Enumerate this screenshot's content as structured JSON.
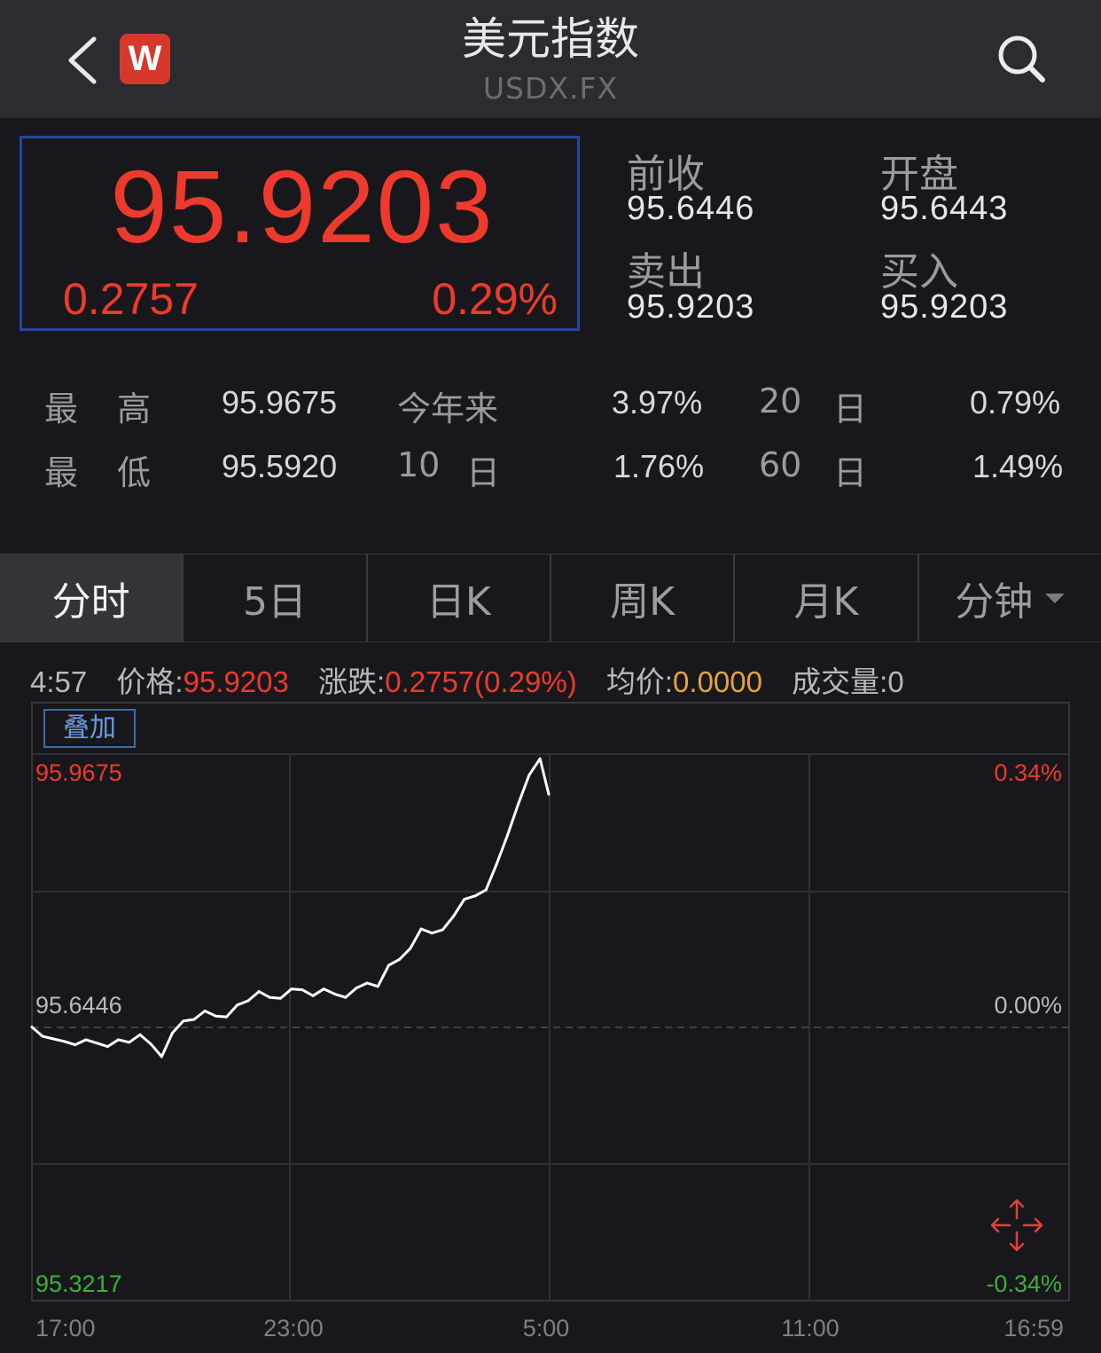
{
  "header": {
    "back_icon": "chevron-left-icon",
    "logo_text": "W",
    "title": "美元指数",
    "code": "USDX.FX",
    "search_icon": "search-icon"
  },
  "quote": {
    "price": "95.9203",
    "change": "0.2757",
    "change_pct": "0.29%",
    "prev_close_label": "前收",
    "prev_close": "95.6446",
    "open_label": "开盘",
    "open": "95.6443",
    "sell_label": "卖出",
    "sell": "95.9203",
    "buy_label": "买入",
    "buy": "95.9203"
  },
  "stats": {
    "high_label_1": "最",
    "high_label_2": "高",
    "high": "95.9675",
    "low_label_1": "最",
    "low_label_2": "低",
    "low": "95.5920",
    "ytd_label": "今年来",
    "ytd": "3.97%",
    "d10_num": "10",
    "d10_unit": "日",
    "d10": "1.76%",
    "d20_num": "20",
    "d20_unit": "日",
    "d20": "0.79%",
    "d60_num": "60",
    "d60_unit": "日",
    "d60": "1.49%"
  },
  "tabs": [
    {
      "label": "分时",
      "active": true
    },
    {
      "label": "5日"
    },
    {
      "label": "日K"
    },
    {
      "label": "周K"
    },
    {
      "label": "月K"
    },
    {
      "label": "分钟",
      "dropdown": true
    }
  ],
  "info": {
    "time": "4:57",
    "price_label": "价格:",
    "price": "95.9203",
    "change_label": "涨跌:",
    "change": "0.2757(0.29%)",
    "avg_label": "均价:",
    "avg": "0.0000",
    "volume_label": "成交量:",
    "volume": "0"
  },
  "overlay_button": "叠加",
  "colors": {
    "up": "#ee3a2c",
    "down": "#3fae3a",
    "accent_blue": "#2545a0",
    "avg": "#e6a23c",
    "line": "#ffffff"
  },
  "chart_data": {
    "type": "line",
    "y_left_ticks": [
      "95.9675",
      "95.6446",
      "95.3217"
    ],
    "y_right_ticks": [
      "0.34%",
      "0.00%",
      "-0.34%"
    ],
    "x_ticks": [
      "17:00",
      "23:00",
      "5:00",
      "11:00",
      "16:59"
    ],
    "ylim": [
      95.3217,
      95.9675
    ],
    "reference": 95.6446,
    "x_range_minutes": [
      0,
      1439
    ],
    "series": [
      {
        "x": [
          0,
          15,
          30,
          45,
          60,
          75,
          90,
          105,
          120,
          135,
          150,
          165,
          180,
          195,
          210,
          225,
          240,
          255,
          270,
          285,
          300,
          315,
          330,
          345,
          360,
          375,
          390,
          405,
          420,
          435,
          450,
          465,
          480,
          495,
          510,
          525,
          540,
          555,
          570,
          585,
          600,
          615,
          630,
          645,
          660,
          675,
          690,
          705,
          717
        ],
        "values": [
          95.645,
          95.634,
          95.631,
          95.628,
          95.624,
          95.63,
          95.626,
          95.622,
          95.63,
          95.627,
          95.636,
          95.625,
          95.61,
          95.638,
          95.652,
          95.654,
          95.664,
          95.658,
          95.657,
          95.671,
          95.676,
          95.687,
          95.68,
          95.679,
          95.69,
          95.689,
          95.682,
          95.69,
          95.684,
          95.68,
          95.691,
          95.697,
          95.693,
          95.718,
          95.725,
          95.738,
          95.761,
          95.756,
          95.76,
          95.776,
          95.796,
          95.8,
          95.807,
          95.838,
          95.872,
          95.909,
          95.943,
          95.962,
          95.92
        ]
      }
    ]
  }
}
